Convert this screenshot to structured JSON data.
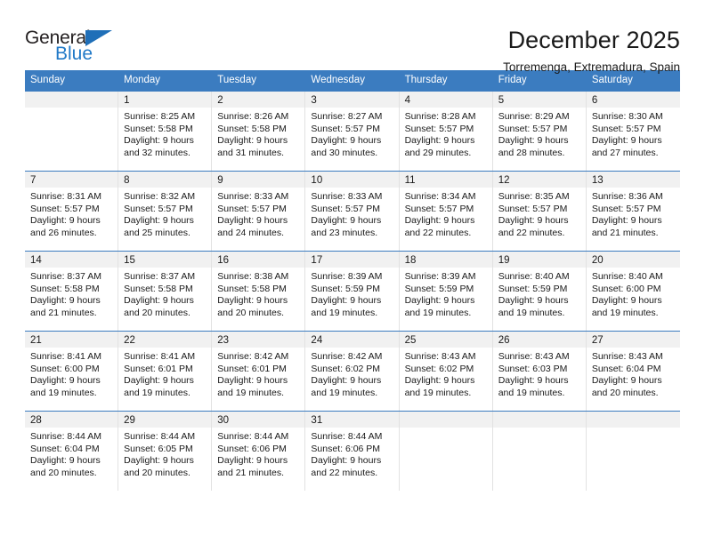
{
  "brand": {
    "line1": "General",
    "line2": "Blue",
    "flag_color": "#1f6fb8",
    "text_color": "#231f20",
    "accent_color": "#2079c7"
  },
  "header": {
    "title": "December 2025",
    "subtitle": "Torremenga, Extremadura, Spain"
  },
  "theme": {
    "header_bar_color": "#3b7cc0",
    "daynum_bg": "#f1f1f1",
    "cell_border": "#e2e2e2"
  },
  "weekdays": [
    "Sunday",
    "Monday",
    "Tuesday",
    "Wednesday",
    "Thursday",
    "Friday",
    "Saturday"
  ],
  "weeks": [
    {
      "days": [
        {
          "day": "",
          "sunrise": "",
          "sunset": "",
          "daylight_l1": "",
          "daylight_l2": ""
        },
        {
          "day": "1",
          "sunrise": "Sunrise: 8:25 AM",
          "sunset": "Sunset: 5:58 PM",
          "daylight_l1": "Daylight: 9 hours",
          "daylight_l2": "and 32 minutes."
        },
        {
          "day": "2",
          "sunrise": "Sunrise: 8:26 AM",
          "sunset": "Sunset: 5:58 PM",
          "daylight_l1": "Daylight: 9 hours",
          "daylight_l2": "and 31 minutes."
        },
        {
          "day": "3",
          "sunrise": "Sunrise: 8:27 AM",
          "sunset": "Sunset: 5:57 PM",
          "daylight_l1": "Daylight: 9 hours",
          "daylight_l2": "and 30 minutes."
        },
        {
          "day": "4",
          "sunrise": "Sunrise: 8:28 AM",
          "sunset": "Sunset: 5:57 PM",
          "daylight_l1": "Daylight: 9 hours",
          "daylight_l2": "and 29 minutes."
        },
        {
          "day": "5",
          "sunrise": "Sunrise: 8:29 AM",
          "sunset": "Sunset: 5:57 PM",
          "daylight_l1": "Daylight: 9 hours",
          "daylight_l2": "and 28 minutes."
        },
        {
          "day": "6",
          "sunrise": "Sunrise: 8:30 AM",
          "sunset": "Sunset: 5:57 PM",
          "daylight_l1": "Daylight: 9 hours",
          "daylight_l2": "and 27 minutes."
        }
      ]
    },
    {
      "days": [
        {
          "day": "7",
          "sunrise": "Sunrise: 8:31 AM",
          "sunset": "Sunset: 5:57 PM",
          "daylight_l1": "Daylight: 9 hours",
          "daylight_l2": "and 26 minutes."
        },
        {
          "day": "8",
          "sunrise": "Sunrise: 8:32 AM",
          "sunset": "Sunset: 5:57 PM",
          "daylight_l1": "Daylight: 9 hours",
          "daylight_l2": "and 25 minutes."
        },
        {
          "day": "9",
          "sunrise": "Sunrise: 8:33 AM",
          "sunset": "Sunset: 5:57 PM",
          "daylight_l1": "Daylight: 9 hours",
          "daylight_l2": "and 24 minutes."
        },
        {
          "day": "10",
          "sunrise": "Sunrise: 8:33 AM",
          "sunset": "Sunset: 5:57 PM",
          "daylight_l1": "Daylight: 9 hours",
          "daylight_l2": "and 23 minutes."
        },
        {
          "day": "11",
          "sunrise": "Sunrise: 8:34 AM",
          "sunset": "Sunset: 5:57 PM",
          "daylight_l1": "Daylight: 9 hours",
          "daylight_l2": "and 22 minutes."
        },
        {
          "day": "12",
          "sunrise": "Sunrise: 8:35 AM",
          "sunset": "Sunset: 5:57 PM",
          "daylight_l1": "Daylight: 9 hours",
          "daylight_l2": "and 22 minutes."
        },
        {
          "day": "13",
          "sunrise": "Sunrise: 8:36 AM",
          "sunset": "Sunset: 5:57 PM",
          "daylight_l1": "Daylight: 9 hours",
          "daylight_l2": "and 21 minutes."
        }
      ]
    },
    {
      "days": [
        {
          "day": "14",
          "sunrise": "Sunrise: 8:37 AM",
          "sunset": "Sunset: 5:58 PM",
          "daylight_l1": "Daylight: 9 hours",
          "daylight_l2": "and 21 minutes."
        },
        {
          "day": "15",
          "sunrise": "Sunrise: 8:37 AM",
          "sunset": "Sunset: 5:58 PM",
          "daylight_l1": "Daylight: 9 hours",
          "daylight_l2": "and 20 minutes."
        },
        {
          "day": "16",
          "sunrise": "Sunrise: 8:38 AM",
          "sunset": "Sunset: 5:58 PM",
          "daylight_l1": "Daylight: 9 hours",
          "daylight_l2": "and 20 minutes."
        },
        {
          "day": "17",
          "sunrise": "Sunrise: 8:39 AM",
          "sunset": "Sunset: 5:59 PM",
          "daylight_l1": "Daylight: 9 hours",
          "daylight_l2": "and 19 minutes."
        },
        {
          "day": "18",
          "sunrise": "Sunrise: 8:39 AM",
          "sunset": "Sunset: 5:59 PM",
          "daylight_l1": "Daylight: 9 hours",
          "daylight_l2": "and 19 minutes."
        },
        {
          "day": "19",
          "sunrise": "Sunrise: 8:40 AM",
          "sunset": "Sunset: 5:59 PM",
          "daylight_l1": "Daylight: 9 hours",
          "daylight_l2": "and 19 minutes."
        },
        {
          "day": "20",
          "sunrise": "Sunrise: 8:40 AM",
          "sunset": "Sunset: 6:00 PM",
          "daylight_l1": "Daylight: 9 hours",
          "daylight_l2": "and 19 minutes."
        }
      ]
    },
    {
      "days": [
        {
          "day": "21",
          "sunrise": "Sunrise: 8:41 AM",
          "sunset": "Sunset: 6:00 PM",
          "daylight_l1": "Daylight: 9 hours",
          "daylight_l2": "and 19 minutes."
        },
        {
          "day": "22",
          "sunrise": "Sunrise: 8:41 AM",
          "sunset": "Sunset: 6:01 PM",
          "daylight_l1": "Daylight: 9 hours",
          "daylight_l2": "and 19 minutes."
        },
        {
          "day": "23",
          "sunrise": "Sunrise: 8:42 AM",
          "sunset": "Sunset: 6:01 PM",
          "daylight_l1": "Daylight: 9 hours",
          "daylight_l2": "and 19 minutes."
        },
        {
          "day": "24",
          "sunrise": "Sunrise: 8:42 AM",
          "sunset": "Sunset: 6:02 PM",
          "daylight_l1": "Daylight: 9 hours",
          "daylight_l2": "and 19 minutes."
        },
        {
          "day": "25",
          "sunrise": "Sunrise: 8:43 AM",
          "sunset": "Sunset: 6:02 PM",
          "daylight_l1": "Daylight: 9 hours",
          "daylight_l2": "and 19 minutes."
        },
        {
          "day": "26",
          "sunrise": "Sunrise: 8:43 AM",
          "sunset": "Sunset: 6:03 PM",
          "daylight_l1": "Daylight: 9 hours",
          "daylight_l2": "and 19 minutes."
        },
        {
          "day": "27",
          "sunrise": "Sunrise: 8:43 AM",
          "sunset": "Sunset: 6:04 PM",
          "daylight_l1": "Daylight: 9 hours",
          "daylight_l2": "and 20 minutes."
        }
      ]
    },
    {
      "days": [
        {
          "day": "28",
          "sunrise": "Sunrise: 8:44 AM",
          "sunset": "Sunset: 6:04 PM",
          "daylight_l1": "Daylight: 9 hours",
          "daylight_l2": "and 20 minutes."
        },
        {
          "day": "29",
          "sunrise": "Sunrise: 8:44 AM",
          "sunset": "Sunset: 6:05 PM",
          "daylight_l1": "Daylight: 9 hours",
          "daylight_l2": "and 20 minutes."
        },
        {
          "day": "30",
          "sunrise": "Sunrise: 8:44 AM",
          "sunset": "Sunset: 6:06 PM",
          "daylight_l1": "Daylight: 9 hours",
          "daylight_l2": "and 21 minutes."
        },
        {
          "day": "31",
          "sunrise": "Sunrise: 8:44 AM",
          "sunset": "Sunset: 6:06 PM",
          "daylight_l1": "Daylight: 9 hours",
          "daylight_l2": "and 22 minutes."
        },
        {
          "day": "",
          "sunrise": "",
          "sunset": "",
          "daylight_l1": "",
          "daylight_l2": ""
        },
        {
          "day": "",
          "sunrise": "",
          "sunset": "",
          "daylight_l1": "",
          "daylight_l2": ""
        },
        {
          "day": "",
          "sunrise": "",
          "sunset": "",
          "daylight_l1": "",
          "daylight_l2": ""
        }
      ]
    }
  ]
}
